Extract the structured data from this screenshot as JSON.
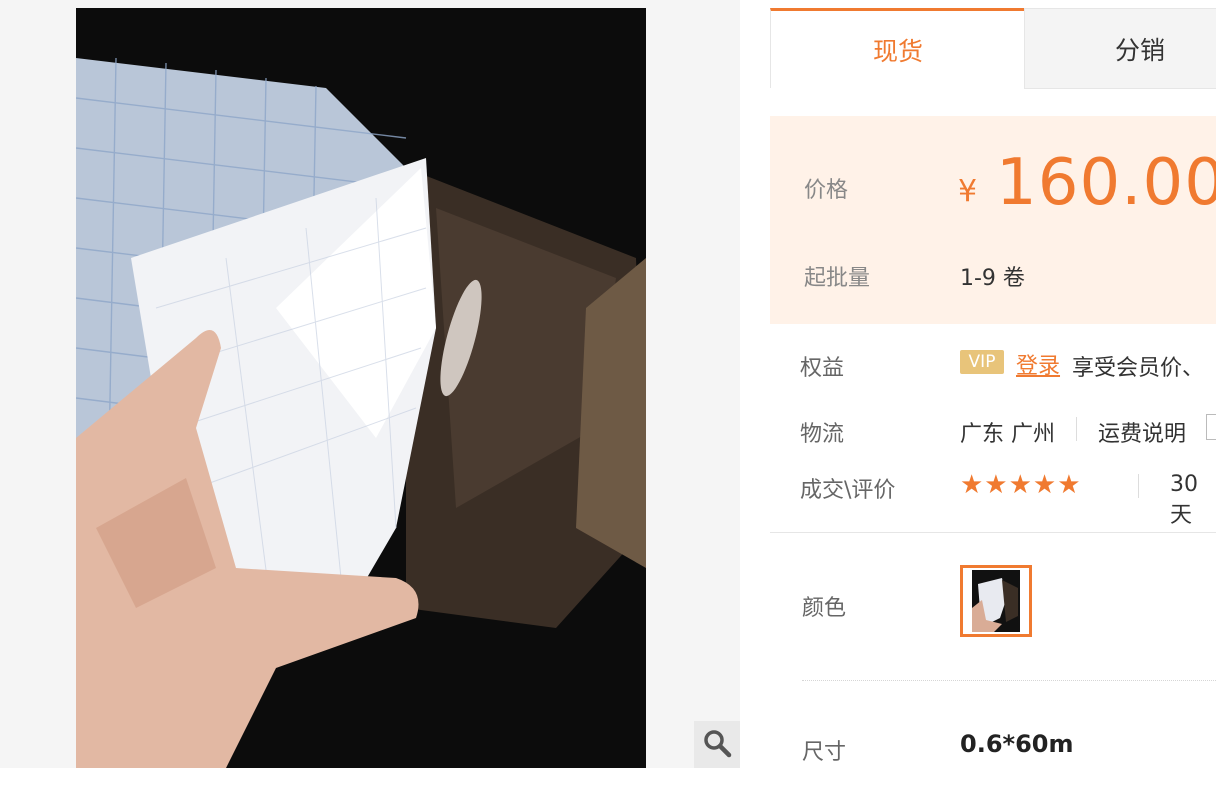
{
  "tabs": [
    {
      "label": "现货",
      "active": true
    },
    {
      "label": "分销",
      "active": false
    }
  ],
  "price": {
    "label": "价格",
    "currency": "¥",
    "amount": "160.00"
  },
  "moq": {
    "label": "起批量",
    "value": "1-9 卷"
  },
  "benefits": {
    "label": "权益",
    "vip_badge": "VIP",
    "login_link": "登录",
    "text": "享受会员价、"
  },
  "logistics": {
    "label": "物流",
    "location": "广东 广州",
    "freight_link": "运费说明"
  },
  "trade": {
    "label": "成交\\评价",
    "stars": "★★★★★",
    "rating": 5,
    "sales_text": "30天"
  },
  "color": {
    "label": "颜色"
  },
  "size": {
    "label": "尺寸",
    "value": "0.6*60m"
  },
  "icons": {
    "zoom": "magnifier-icon"
  },
  "colors": {
    "accent": "#f07a30",
    "price_bg": "#fff2e8",
    "vip": "#e8c47a"
  }
}
